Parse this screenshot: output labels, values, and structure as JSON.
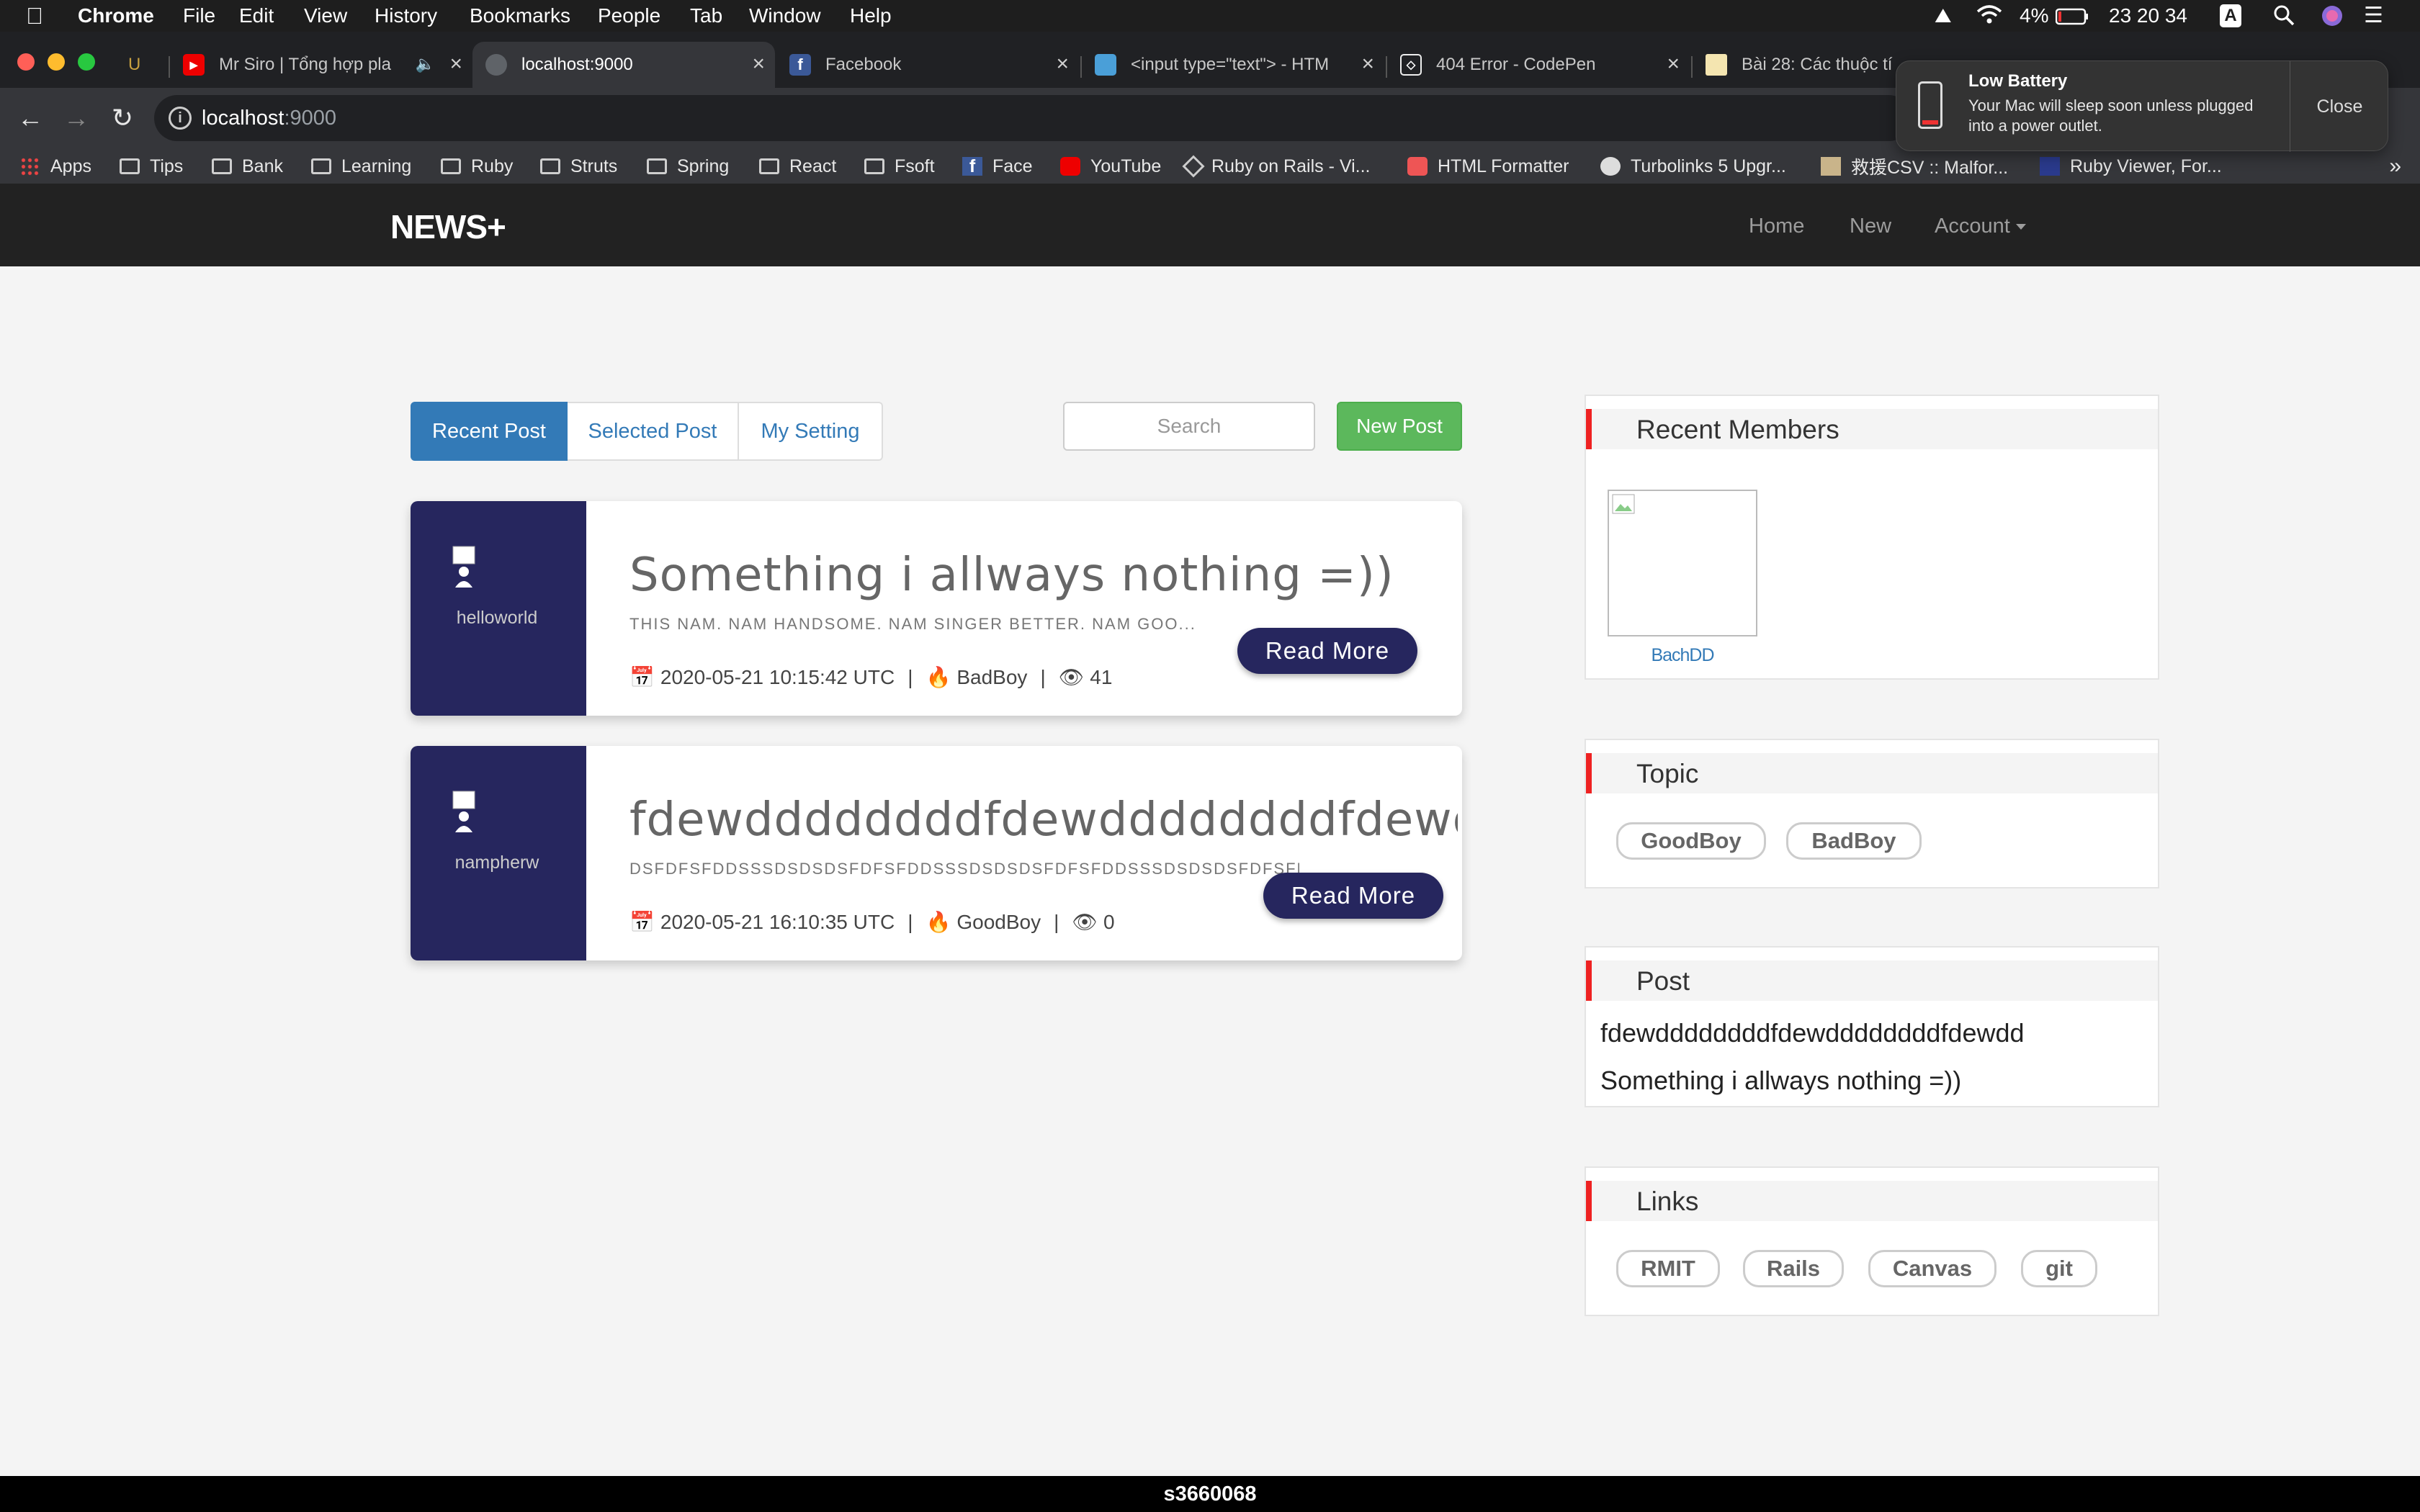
{
  "menubar": {
    "app": "Chrome",
    "items": [
      "File",
      "Edit",
      "View",
      "History",
      "Bookmarks",
      "People",
      "Tab",
      "Window",
      "Help"
    ],
    "battery": "4%",
    "clock": "23 20 34",
    "input_source": "A"
  },
  "tabs": [
    {
      "title": "U"
    },
    {
      "title": "Mr Siro | Tổng hợp pla"
    },
    {
      "title": "localhost:9000"
    },
    {
      "title": "Facebook"
    },
    {
      "title": "<input type=\"text\"> - HTM"
    },
    {
      "title": "404 Error - CodePen"
    },
    {
      "title": "Bài 28: Các thuộc tí"
    }
  ],
  "omnibox": {
    "host": "localhost",
    "port": ":9000"
  },
  "bookmarks": [
    "Apps",
    "Tips",
    "Bank",
    "Learning",
    "Ruby",
    "Struts",
    "Spring",
    "React",
    "Fsoft",
    "Face",
    "YouTube",
    "Ruby on Rails - Vi...",
    "HTML Formatter",
    "Turbolinks 5 Upgr...",
    "救援CSV :: Malfor...",
    "Ruby Viewer, For..."
  ],
  "notification": {
    "title": "Low Battery",
    "message": "Your Mac will sleep soon unless plugged into a power outlet.",
    "close": "Close"
  },
  "site": {
    "brand": "NEWS+",
    "nav": {
      "home": "Home",
      "new": "New",
      "account": "Account"
    }
  },
  "content_tabs": [
    "Recent Post",
    "Selected Post",
    "My Setting"
  ],
  "search": {
    "placeholder": "Search"
  },
  "new_post_label": "New Post",
  "posts": [
    {
      "user": "helloworld",
      "title": "Something i allways nothing =))",
      "subtitle": "THIS NAM. NAM HANDSOME. NAM SINGER BETTER. NAM GOO...",
      "date": "2020-05-21 10:15:42 UTC",
      "topic": "BadBoy",
      "views": "41",
      "read_more": "Read More"
    },
    {
      "user": "nampherw",
      "title": "fdewddddddddfdewddddddddfdewdd",
      "subtitle": "DSFDFSFDDSSSDSDSDSFDFSFDDSSSDSDSDSFDFSFDDSSSDSDSDSFDFSFD",
      "date": "2020-05-21 16:10:35 UTC",
      "topic": "GoodBoy",
      "views": "0",
      "read_more": "Read More"
    }
  ],
  "sidebar": {
    "recent_members": {
      "title": "Recent Members",
      "members": [
        "BachDD"
      ]
    },
    "topic": {
      "title": "Topic",
      "items": [
        "GoodBoy",
        "BadBoy"
      ]
    },
    "post": {
      "title": "Post",
      "items": [
        "fdewddddddddfdewddddddddfdewdd",
        "Something i allways nothing =))"
      ]
    },
    "links": {
      "title": "Links",
      "items": [
        "RMIT",
        "Rails",
        "Canvas",
        "git"
      ]
    }
  },
  "footer": "s3660068",
  "colors": {
    "primary": "#337ab7",
    "success": "#5cb85c",
    "card_navy": "#26265e",
    "widget_accent": "#ee2222",
    "navbar": "#222222"
  }
}
